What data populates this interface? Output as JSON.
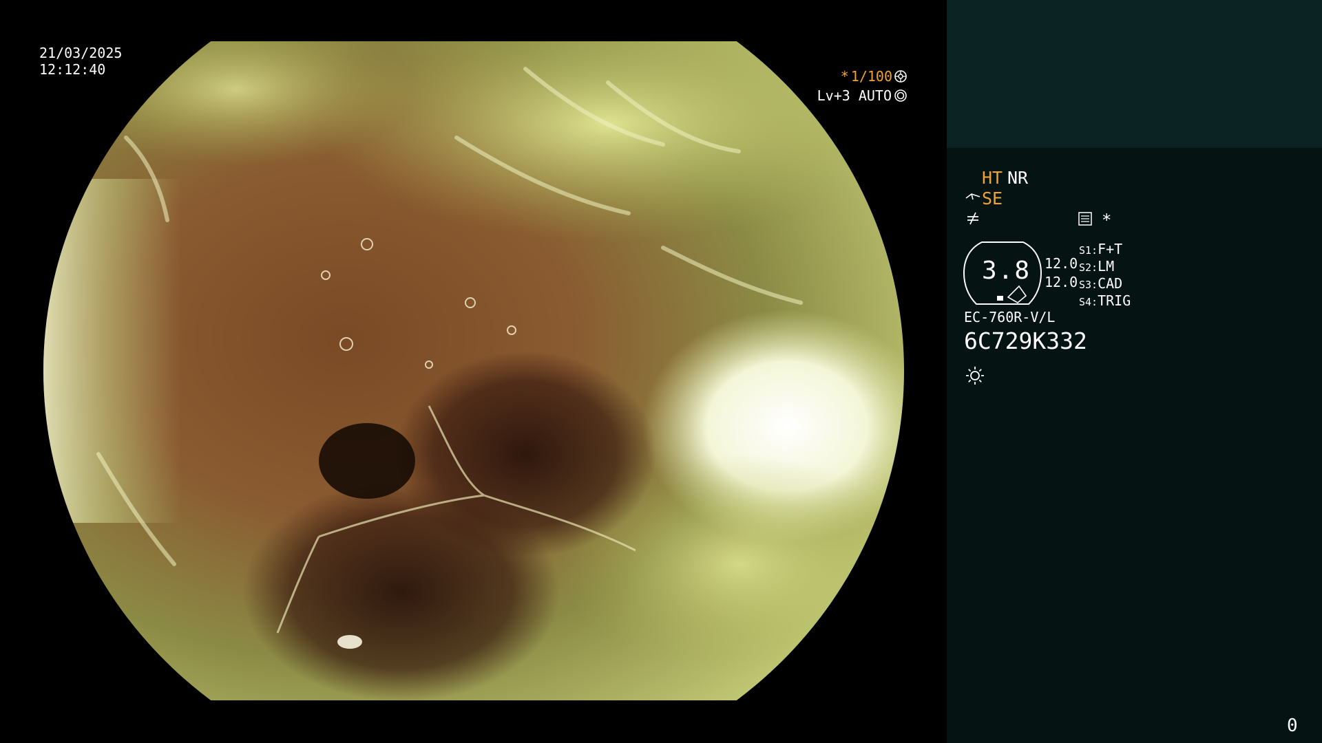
{
  "overlay": {
    "date": "21/03/2025",
    "time": "12:12:40",
    "shutter_prefix": "*",
    "shutter": "1/100",
    "exposure": "Lv+3 AUTO"
  },
  "panel": {
    "ht": "HT",
    "nr": "NR",
    "se": "SE",
    "asterisk": "*",
    "gauge_value": "3.8",
    "value_1": "12.0",
    "value_2": "12.0",
    "switches": [
      {
        "key": "S1:",
        "value": "F+T"
      },
      {
        "key": "S2:",
        "value": "LM"
      },
      {
        "key": "S3:",
        "value": "CAD"
      },
      {
        "key": "S4:",
        "value": "TRIG"
      }
    ],
    "model": "EC-760R-V/L",
    "serial": "6C729K332",
    "counter": "0"
  },
  "icons": {
    "shutter_icon": "aperture-icon",
    "exposure_icon": "iris-icon",
    "se_icon": "scope-hand-icon",
    "notequal_icon": "not-equal-icon",
    "menu_icon": "settings-list-icon",
    "sun_icon": "brightness-icon"
  },
  "colors": {
    "accent": "#f0a330",
    "panel_top": "#0c2324",
    "panel_bottom": "#051312"
  }
}
